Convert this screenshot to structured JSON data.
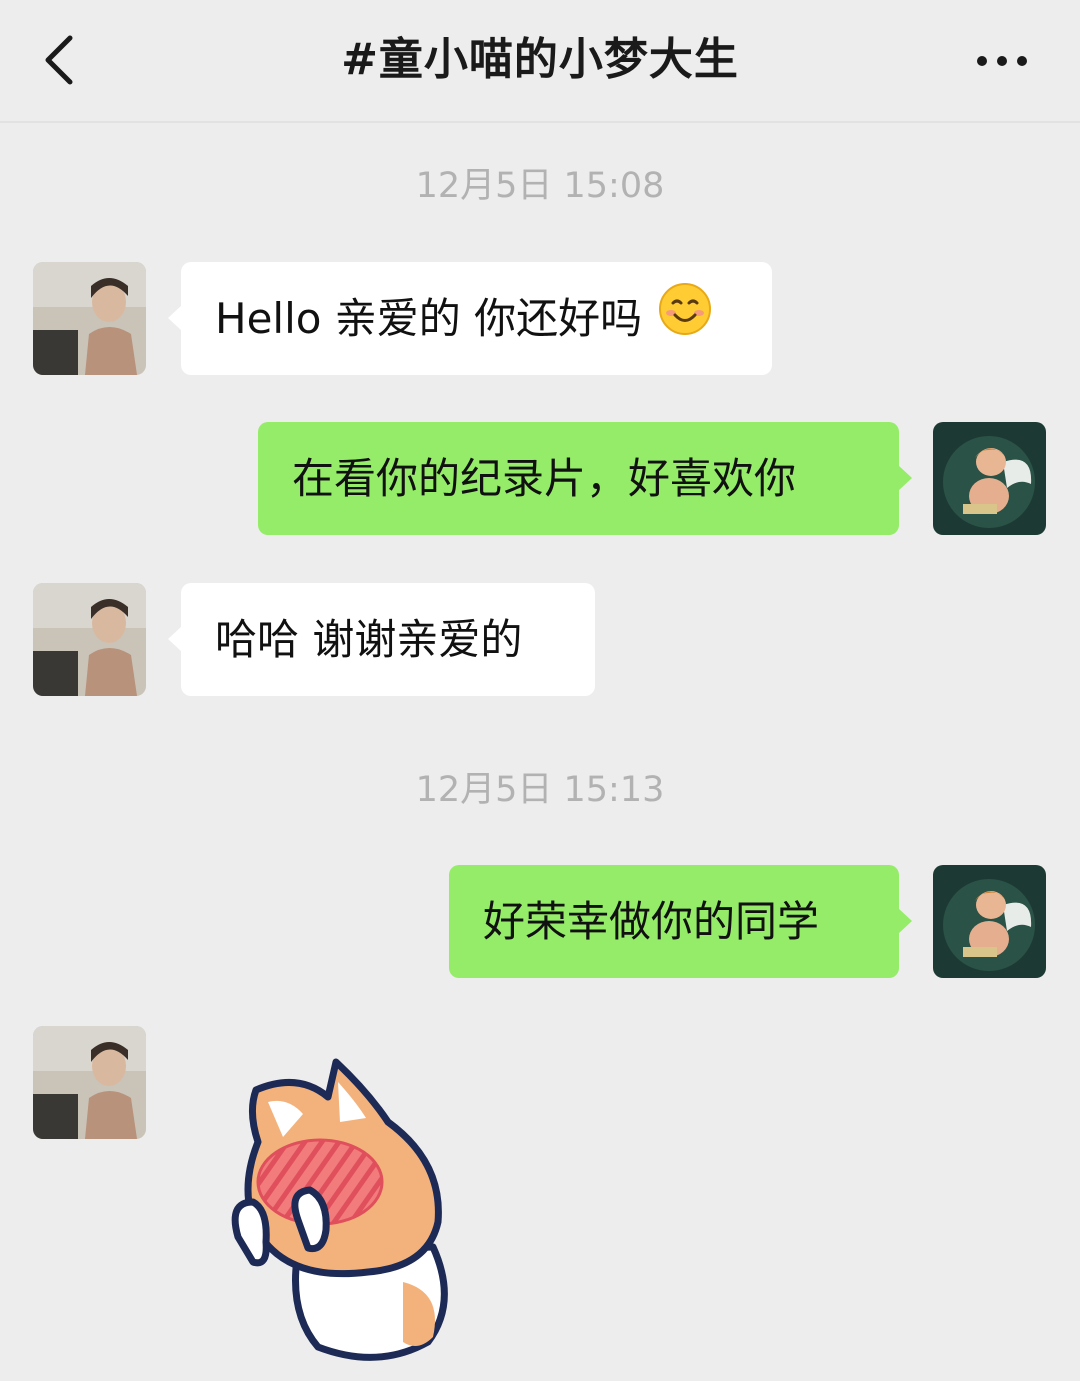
{
  "header": {
    "title": "#童小喵的小梦大生",
    "back_icon": "chevron-left-icon",
    "more_icon": "ellipsis-icon"
  },
  "messages": {
    "timestamp_1": "12月5日 15:08",
    "msg_1": "Hello 亲爱的 你还好吗",
    "msg_1_emoji": "smiling-face-emoji",
    "msg_2": "在看你的纪录片，好喜欢你",
    "msg_3": "哈哈 谢谢亲爱的",
    "timestamp_2": "12月5日 15:13",
    "msg_4": "好荣幸做你的同学",
    "msg_5_sticker": "shy-cat-sticker"
  },
  "colors": {
    "background": "#ededed",
    "incoming_bubble": "#ffffff",
    "outgoing_bubble": "#95ec69",
    "timestamp_text": "#b2b2b2"
  }
}
